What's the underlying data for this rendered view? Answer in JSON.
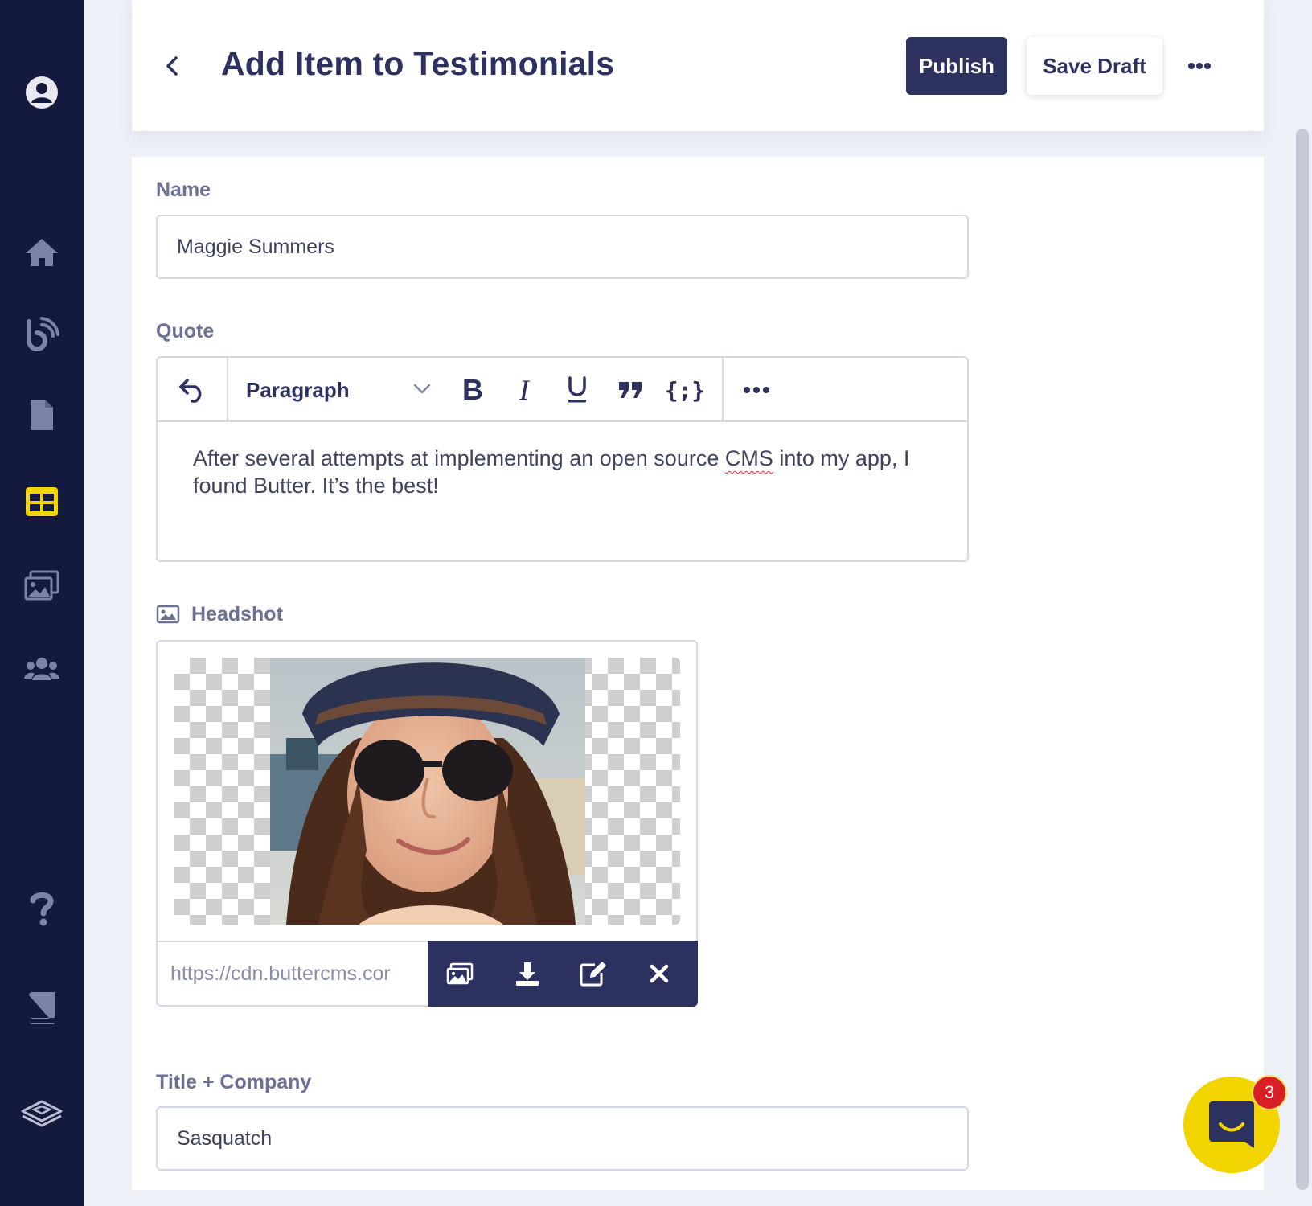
{
  "app": {
    "accent": "#f2d400",
    "brand_dark": "#141a3d",
    "primary": "#2c3160"
  },
  "sidebar": {
    "items": [
      {
        "icon": "avatar-icon"
      },
      {
        "icon": "home-icon"
      },
      {
        "icon": "blog-icon"
      },
      {
        "icon": "page-icon"
      },
      {
        "icon": "collections-icon",
        "active": true
      },
      {
        "icon": "media-icon"
      },
      {
        "icon": "users-icon"
      },
      {
        "icon": "help-icon"
      },
      {
        "icon": "docs-icon"
      },
      {
        "icon": "logo-icon"
      }
    ]
  },
  "header": {
    "title": "Add Item to Testimonials",
    "publish_label": "Publish",
    "save_draft_label": "Save Draft",
    "more_icon": "more-horizontal-icon"
  },
  "form": {
    "name": {
      "label": "Name",
      "value": "Maggie Summers"
    },
    "quote": {
      "label": "Quote",
      "format_select": "Paragraph",
      "toolbar_icons": [
        "undo-icon",
        "bold-icon",
        "italic-icon",
        "underline-icon",
        "blockquote-icon",
        "code-icon",
        "more-horizontal-icon"
      ],
      "text_before": "After several attempts at implementing an open source ",
      "text_misspelled": "CMS",
      "text_after": " into my app, I found Butter. It’s the best!"
    },
    "headshot": {
      "label": "Headshot",
      "url": "https://cdn.buttercms.cor",
      "actions": [
        "media-library-icon",
        "download-icon",
        "edit-icon",
        "remove-icon"
      ]
    },
    "title_company": {
      "label": "Title + Company",
      "value": "Sasquatch"
    }
  },
  "chat": {
    "badge_count": "3"
  }
}
